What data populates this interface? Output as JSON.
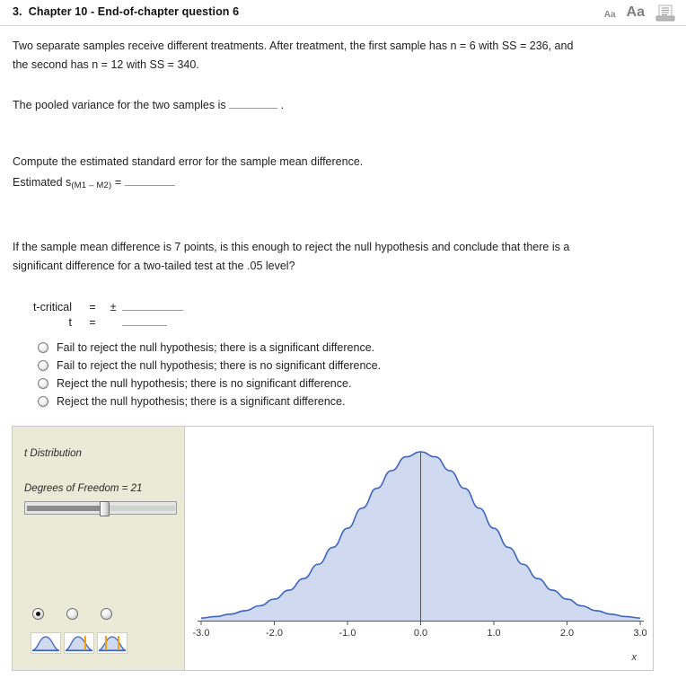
{
  "header": {
    "number": "3.",
    "title": "Chapter 10 - End-of-chapter question 6",
    "tools": {
      "decrease_font_label": "Aa",
      "increase_font_label": "Aa",
      "print_icon_name": "print-icon"
    }
  },
  "body": {
    "intro_line1": "Two separate samples receive different treatments. After treatment, the first sample has n = 6 with SS = 236, and",
    "intro_line2": "the second has n = 12 with SS = 340.",
    "pooled_prompt": "The pooled variance for the two samples is",
    "pooled_period": ".",
    "pooled_answer": "",
    "se_prompt": "Compute the estimated standard error for the sample mean difference.",
    "se_label_prefix": "Estimated s",
    "se_label_subscript": "(M1 – M2)",
    "se_label_equals": "=",
    "se_answer": "",
    "question_line1": "If the sample mean difference is 7 points, is this enough to reject the null hypothesis and conclude that there is a",
    "question_line2": "significant difference for a two-tailed test at the .05 level?"
  },
  "tcritical": {
    "row1_label": "t-critical",
    "row1_equals": "=",
    "row1_pm": "±",
    "row1_value": "",
    "row2_label": "t",
    "row2_equals": "=",
    "row2_value": ""
  },
  "choices": {
    "selected_index": -1,
    "options": [
      "Fail to reject the null hypothesis; there is a significant difference.",
      "Fail to reject the null hypothesis; there is no significant difference.",
      "Reject the null hypothesis; there is no significant difference.",
      "Reject the null hypothesis; there is a significant difference."
    ]
  },
  "applet": {
    "title": "t Distribution",
    "dof_label": "Degrees of Freedom = 21",
    "dof_value": 21,
    "slider": {
      "min": 1,
      "max": 40,
      "value": 21,
      "percent": 52
    },
    "tail_mode": {
      "selected_index": 0,
      "options": [
        "no-tails",
        "one-tail-right",
        "two-tails"
      ]
    },
    "colors": {
      "panel_bg": "#eaead7",
      "curve_stroke": "#3f64bf",
      "curve_fill": "#cfd9f0",
      "center_line": "#555555",
      "tail_marker": "#f2a20c"
    },
    "chart_data": {
      "type": "line",
      "title": "t Distribution",
      "xlabel": "x",
      "ylabel": "",
      "xlim": [
        -3.0,
        3.0
      ],
      "xticks": [
        "-3.0",
        "-2.0",
        "-1.0",
        "0.0",
        "1.0",
        "2.0",
        "3.0"
      ],
      "xtick_values": [
        -3.0,
        -2.0,
        -1.0,
        0.0,
        1.0,
        2.0,
        3.0
      ],
      "grid": false,
      "legend": false,
      "series": [
        {
          "name": "t density (df = 21)",
          "x": [
            -3.0,
            -2.8,
            -2.6,
            -2.4,
            -2.2,
            -2.0,
            -1.8,
            -1.6,
            -1.4,
            -1.2,
            -1.0,
            -0.8,
            -0.6,
            -0.4,
            -0.2,
            0.0,
            0.2,
            0.4,
            0.6,
            0.8,
            1.0,
            1.2,
            1.4,
            1.6,
            1.8,
            2.0,
            2.2,
            2.4,
            2.6,
            2.8,
            3.0
          ],
          "y": [
            0.0068,
            0.0109,
            0.0171,
            0.0262,
            0.0391,
            0.0568,
            0.0805,
            0.111,
            0.1487,
            0.1934,
            0.2436,
            0.2968,
            0.349,
            0.3957,
            0.4322,
            0.4455,
            0.4322,
            0.3957,
            0.349,
            0.2968,
            0.2436,
            0.1934,
            0.1487,
            0.111,
            0.0805,
            0.0568,
            0.0391,
            0.0262,
            0.0171,
            0.0109,
            0.0068
          ]
        }
      ],
      "annotations": [
        {
          "type": "vline",
          "x": 0.0,
          "label": "center line"
        }
      ]
    }
  }
}
